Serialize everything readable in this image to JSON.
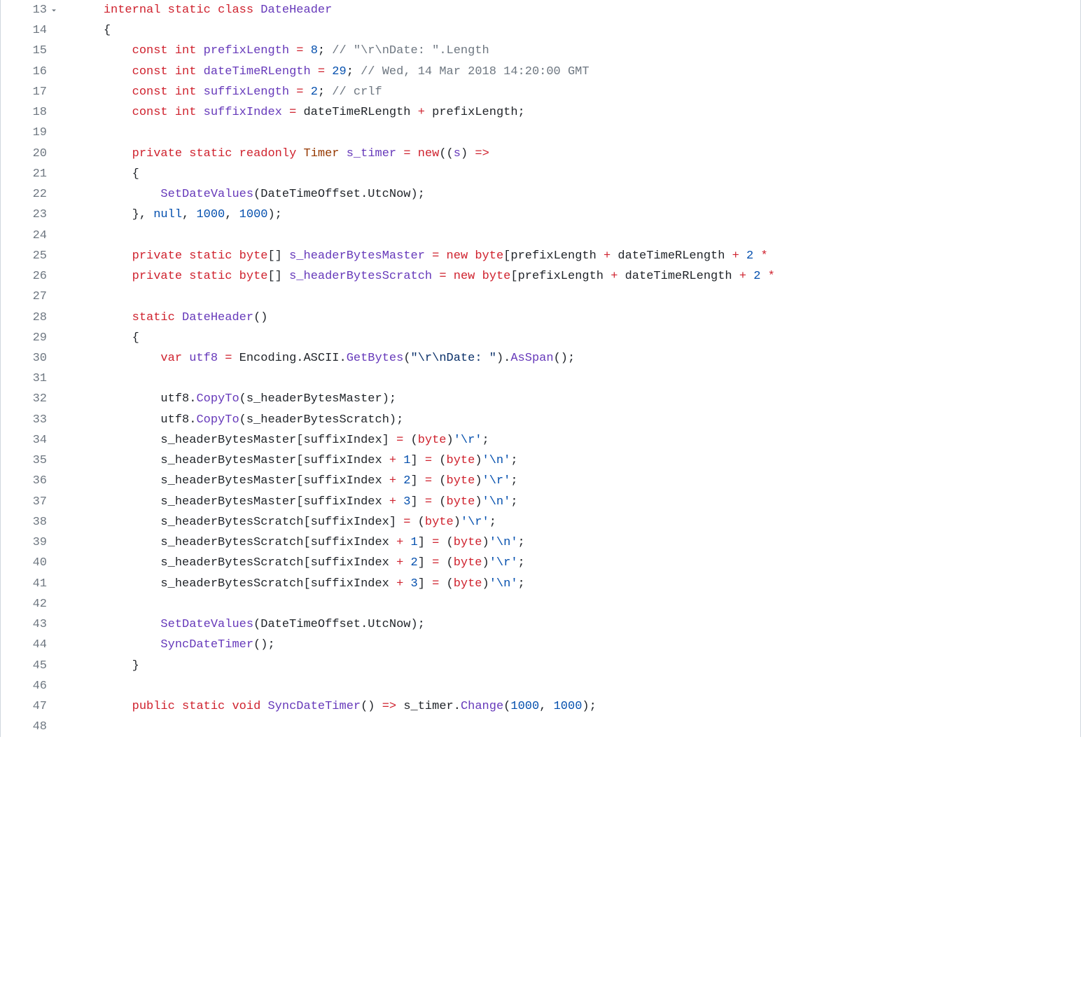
{
  "code": {
    "startLine": 13,
    "lines": [
      {
        "n": 13,
        "fold": true,
        "indent": 1,
        "tokens": [
          [
            "kw",
            "internal"
          ],
          [
            "pn",
            " "
          ],
          [
            "kw",
            "static"
          ],
          [
            "pn",
            " "
          ],
          [
            "kw",
            "class"
          ],
          [
            "pn",
            " "
          ],
          [
            "id",
            "DateHeader"
          ]
        ]
      },
      {
        "n": 14,
        "indent": 1,
        "tokens": [
          [
            "pn",
            "{"
          ]
        ]
      },
      {
        "n": 15,
        "indent": 2,
        "tokens": [
          [
            "kw",
            "const"
          ],
          [
            "pn",
            " "
          ],
          [
            "ty",
            "int"
          ],
          [
            "pn",
            " "
          ],
          [
            "id",
            "prefixLength"
          ],
          [
            "pn",
            " "
          ],
          [
            "kw",
            "="
          ],
          [
            "pn",
            " "
          ],
          [
            "num",
            "8"
          ],
          [
            "pn",
            "; "
          ],
          [
            "cmt",
            "// \"\\r\\nDate: \".Length"
          ]
        ]
      },
      {
        "n": 16,
        "indent": 2,
        "tokens": [
          [
            "kw",
            "const"
          ],
          [
            "pn",
            " "
          ],
          [
            "ty",
            "int"
          ],
          [
            "pn",
            " "
          ],
          [
            "id",
            "dateTimeRLength"
          ],
          [
            "pn",
            " "
          ],
          [
            "kw",
            "="
          ],
          [
            "pn",
            " "
          ],
          [
            "num",
            "29"
          ],
          [
            "pn",
            "; "
          ],
          [
            "cmt",
            "// Wed, 14 Mar 2018 14:20:00 GMT"
          ]
        ]
      },
      {
        "n": 17,
        "indent": 2,
        "tokens": [
          [
            "kw",
            "const"
          ],
          [
            "pn",
            " "
          ],
          [
            "ty",
            "int"
          ],
          [
            "pn",
            " "
          ],
          [
            "id",
            "suffixLength"
          ],
          [
            "pn",
            " "
          ],
          [
            "kw",
            "="
          ],
          [
            "pn",
            " "
          ],
          [
            "num",
            "2"
          ],
          [
            "pn",
            "; "
          ],
          [
            "cmt",
            "// crlf"
          ]
        ]
      },
      {
        "n": 18,
        "indent": 2,
        "tokens": [
          [
            "kw",
            "const"
          ],
          [
            "pn",
            " "
          ],
          [
            "ty",
            "int"
          ],
          [
            "pn",
            " "
          ],
          [
            "id",
            "suffixIndex"
          ],
          [
            "pn",
            " "
          ],
          [
            "kw",
            "="
          ],
          [
            "pn",
            " dateTimeRLength "
          ],
          [
            "kw",
            "+"
          ],
          [
            "pn",
            " prefixLength;"
          ]
        ]
      },
      {
        "n": 19,
        "indent": 0,
        "tokens": []
      },
      {
        "n": 20,
        "indent": 2,
        "tokens": [
          [
            "kw",
            "private"
          ],
          [
            "pn",
            " "
          ],
          [
            "kw",
            "static"
          ],
          [
            "pn",
            " "
          ],
          [
            "kw",
            "readonly"
          ],
          [
            "pn",
            " "
          ],
          [
            "cls",
            "Timer"
          ],
          [
            "pn",
            " "
          ],
          [
            "id",
            "s_timer"
          ],
          [
            "pn",
            " "
          ],
          [
            "kw",
            "="
          ],
          [
            "pn",
            " "
          ],
          [
            "kw",
            "new"
          ],
          [
            "pn",
            "(("
          ],
          [
            "id",
            "s"
          ],
          [
            "pn",
            ") "
          ],
          [
            "kw",
            "=>"
          ]
        ]
      },
      {
        "n": 21,
        "indent": 2,
        "tokens": [
          [
            "pn",
            "{"
          ]
        ]
      },
      {
        "n": 22,
        "indent": 3,
        "tokens": [
          [
            "mth",
            "SetDateValues"
          ],
          [
            "pn",
            "(DateTimeOffset.UtcNow);"
          ]
        ]
      },
      {
        "n": 23,
        "indent": 2,
        "tokens": [
          [
            "pn",
            "}, "
          ],
          [
            "num",
            "null"
          ],
          [
            "pn",
            ", "
          ],
          [
            "num",
            "1000"
          ],
          [
            "pn",
            ", "
          ],
          [
            "num",
            "1000"
          ],
          [
            "pn",
            ");"
          ]
        ]
      },
      {
        "n": 24,
        "indent": 0,
        "tokens": []
      },
      {
        "n": 25,
        "indent": 2,
        "tokens": [
          [
            "kw",
            "private"
          ],
          [
            "pn",
            " "
          ],
          [
            "kw",
            "static"
          ],
          [
            "pn",
            " "
          ],
          [
            "ty",
            "byte"
          ],
          [
            "pn",
            "[] "
          ],
          [
            "id",
            "s_headerBytesMaster"
          ],
          [
            "pn",
            " "
          ],
          [
            "kw",
            "="
          ],
          [
            "pn",
            " "
          ],
          [
            "kw",
            "new"
          ],
          [
            "pn",
            " "
          ],
          [
            "ty",
            "byte"
          ],
          [
            "pn",
            "[prefixLength "
          ],
          [
            "kw",
            "+"
          ],
          [
            "pn",
            " dateTimeRLength "
          ],
          [
            "kw",
            "+"
          ],
          [
            "pn",
            " "
          ],
          [
            "num",
            "2"
          ],
          [
            "pn",
            " "
          ],
          [
            "kw",
            "*"
          ]
        ]
      },
      {
        "n": 26,
        "indent": 2,
        "tokens": [
          [
            "kw",
            "private"
          ],
          [
            "pn",
            " "
          ],
          [
            "kw",
            "static"
          ],
          [
            "pn",
            " "
          ],
          [
            "ty",
            "byte"
          ],
          [
            "pn",
            "[] "
          ],
          [
            "id",
            "s_headerBytesScratch"
          ],
          [
            "pn",
            " "
          ],
          [
            "kw",
            "="
          ],
          [
            "pn",
            " "
          ],
          [
            "kw",
            "new"
          ],
          [
            "pn",
            " "
          ],
          [
            "ty",
            "byte"
          ],
          [
            "pn",
            "[prefixLength "
          ],
          [
            "kw",
            "+"
          ],
          [
            "pn",
            " dateTimeRLength "
          ],
          [
            "kw",
            "+"
          ],
          [
            "pn",
            " "
          ],
          [
            "num",
            "2"
          ],
          [
            "pn",
            " "
          ],
          [
            "kw",
            "*"
          ]
        ]
      },
      {
        "n": 27,
        "indent": 0,
        "tokens": []
      },
      {
        "n": 28,
        "indent": 2,
        "tokens": [
          [
            "kw",
            "static"
          ],
          [
            "pn",
            " "
          ],
          [
            "mth",
            "DateHeader"
          ],
          [
            "pn",
            "()"
          ]
        ]
      },
      {
        "n": 29,
        "indent": 2,
        "tokens": [
          [
            "pn",
            "{"
          ]
        ]
      },
      {
        "n": 30,
        "indent": 3,
        "tokens": [
          [
            "ty",
            "var"
          ],
          [
            "pn",
            " "
          ],
          [
            "id",
            "utf8"
          ],
          [
            "pn",
            " "
          ],
          [
            "kw",
            "="
          ],
          [
            "pn",
            " Encoding.ASCII."
          ],
          [
            "mth",
            "GetBytes"
          ],
          [
            "pn",
            "("
          ],
          [
            "str",
            "\"\\r\\nDate: \""
          ],
          [
            "pn",
            ")."
          ],
          [
            "mth",
            "AsSpan"
          ],
          [
            "pn",
            "();"
          ]
        ]
      },
      {
        "n": 31,
        "indent": 0,
        "tokens": []
      },
      {
        "n": 32,
        "indent": 3,
        "tokens": [
          [
            "pn",
            "utf8."
          ],
          [
            "mth",
            "CopyTo"
          ],
          [
            "pn",
            "(s_headerBytesMaster);"
          ]
        ]
      },
      {
        "n": 33,
        "indent": 3,
        "tokens": [
          [
            "pn",
            "utf8."
          ],
          [
            "mth",
            "CopyTo"
          ],
          [
            "pn",
            "(s_headerBytesScratch);"
          ]
        ]
      },
      {
        "n": 34,
        "indent": 3,
        "tokens": [
          [
            "pn",
            "s_headerBytesMaster[suffixIndex] "
          ],
          [
            "kw",
            "="
          ],
          [
            "pn",
            " ("
          ],
          [
            "ty",
            "byte"
          ],
          [
            "pn",
            ")"
          ],
          [
            "chr",
            "'\\r'"
          ],
          [
            "pn",
            ";"
          ]
        ]
      },
      {
        "n": 35,
        "indent": 3,
        "tokens": [
          [
            "pn",
            "s_headerBytesMaster[suffixIndex "
          ],
          [
            "kw",
            "+"
          ],
          [
            "pn",
            " "
          ],
          [
            "num",
            "1"
          ],
          [
            "pn",
            "] "
          ],
          [
            "kw",
            "="
          ],
          [
            "pn",
            " ("
          ],
          [
            "ty",
            "byte"
          ],
          [
            "pn",
            ")"
          ],
          [
            "chr",
            "'\\n'"
          ],
          [
            "pn",
            ";"
          ]
        ]
      },
      {
        "n": 36,
        "indent": 3,
        "tokens": [
          [
            "pn",
            "s_headerBytesMaster[suffixIndex "
          ],
          [
            "kw",
            "+"
          ],
          [
            "pn",
            " "
          ],
          [
            "num",
            "2"
          ],
          [
            "pn",
            "] "
          ],
          [
            "kw",
            "="
          ],
          [
            "pn",
            " ("
          ],
          [
            "ty",
            "byte"
          ],
          [
            "pn",
            ")"
          ],
          [
            "chr",
            "'\\r'"
          ],
          [
            "pn",
            ";"
          ]
        ]
      },
      {
        "n": 37,
        "indent": 3,
        "tokens": [
          [
            "pn",
            "s_headerBytesMaster[suffixIndex "
          ],
          [
            "kw",
            "+"
          ],
          [
            "pn",
            " "
          ],
          [
            "num",
            "3"
          ],
          [
            "pn",
            "] "
          ],
          [
            "kw",
            "="
          ],
          [
            "pn",
            " ("
          ],
          [
            "ty",
            "byte"
          ],
          [
            "pn",
            ")"
          ],
          [
            "chr",
            "'\\n'"
          ],
          [
            "pn",
            ";"
          ]
        ]
      },
      {
        "n": 38,
        "indent": 3,
        "tokens": [
          [
            "pn",
            "s_headerBytesScratch[suffixIndex] "
          ],
          [
            "kw",
            "="
          ],
          [
            "pn",
            " ("
          ],
          [
            "ty",
            "byte"
          ],
          [
            "pn",
            ")"
          ],
          [
            "chr",
            "'\\r'"
          ],
          [
            "pn",
            ";"
          ]
        ]
      },
      {
        "n": 39,
        "indent": 3,
        "tokens": [
          [
            "pn",
            "s_headerBytesScratch[suffixIndex "
          ],
          [
            "kw",
            "+"
          ],
          [
            "pn",
            " "
          ],
          [
            "num",
            "1"
          ],
          [
            "pn",
            "] "
          ],
          [
            "kw",
            "="
          ],
          [
            "pn",
            " ("
          ],
          [
            "ty",
            "byte"
          ],
          [
            "pn",
            ")"
          ],
          [
            "chr",
            "'\\n'"
          ],
          [
            "pn",
            ";"
          ]
        ]
      },
      {
        "n": 40,
        "indent": 3,
        "tokens": [
          [
            "pn",
            "s_headerBytesScratch[suffixIndex "
          ],
          [
            "kw",
            "+"
          ],
          [
            "pn",
            " "
          ],
          [
            "num",
            "2"
          ],
          [
            "pn",
            "] "
          ],
          [
            "kw",
            "="
          ],
          [
            "pn",
            " ("
          ],
          [
            "ty",
            "byte"
          ],
          [
            "pn",
            ")"
          ],
          [
            "chr",
            "'\\r'"
          ],
          [
            "pn",
            ";"
          ]
        ]
      },
      {
        "n": 41,
        "indent": 3,
        "tokens": [
          [
            "pn",
            "s_headerBytesScratch[suffixIndex "
          ],
          [
            "kw",
            "+"
          ],
          [
            "pn",
            " "
          ],
          [
            "num",
            "3"
          ],
          [
            "pn",
            "] "
          ],
          [
            "kw",
            "="
          ],
          [
            "pn",
            " ("
          ],
          [
            "ty",
            "byte"
          ],
          [
            "pn",
            ")"
          ],
          [
            "chr",
            "'\\n'"
          ],
          [
            "pn",
            ";"
          ]
        ]
      },
      {
        "n": 42,
        "indent": 0,
        "tokens": []
      },
      {
        "n": 43,
        "indent": 3,
        "tokens": [
          [
            "mth",
            "SetDateValues"
          ],
          [
            "pn",
            "(DateTimeOffset.UtcNow);"
          ]
        ]
      },
      {
        "n": 44,
        "indent": 3,
        "tokens": [
          [
            "mth",
            "SyncDateTimer"
          ],
          [
            "pn",
            "();"
          ]
        ]
      },
      {
        "n": 45,
        "indent": 2,
        "tokens": [
          [
            "pn",
            "}"
          ]
        ]
      },
      {
        "n": 46,
        "indent": 0,
        "tokens": []
      },
      {
        "n": 47,
        "indent": 2,
        "tokens": [
          [
            "kw",
            "public"
          ],
          [
            "pn",
            " "
          ],
          [
            "kw",
            "static"
          ],
          [
            "pn",
            " "
          ],
          [
            "ty",
            "void"
          ],
          [
            "pn",
            " "
          ],
          [
            "mth",
            "SyncDateTimer"
          ],
          [
            "pn",
            "() "
          ],
          [
            "kw",
            "=>"
          ],
          [
            "pn",
            " s_timer."
          ],
          [
            "mth",
            "Change"
          ],
          [
            "pn",
            "("
          ],
          [
            "num",
            "1000"
          ],
          [
            "pn",
            ", "
          ],
          [
            "num",
            "1000"
          ],
          [
            "pn",
            ");"
          ]
        ]
      },
      {
        "n": 48,
        "indent": 0,
        "tokens": []
      }
    ]
  },
  "indentUnit": "    "
}
